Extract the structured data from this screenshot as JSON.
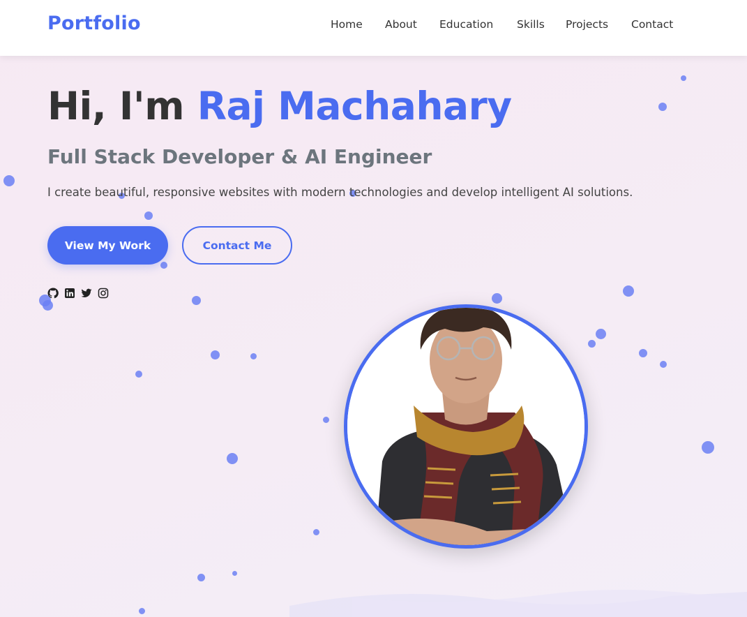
{
  "brand": {
    "logo": "Portfolio",
    "accent": "#4a6cf0"
  },
  "nav": {
    "items": [
      {
        "label": "Home"
      },
      {
        "label": "About"
      },
      {
        "label": "Education"
      },
      {
        "label": "Skills"
      },
      {
        "label": "Projects"
      },
      {
        "label": "Contact"
      }
    ]
  },
  "hero": {
    "greeting": "Hi, I'm ",
    "name": "Raj Machahary",
    "subtitle": "Full Stack Developer & AI Engineer",
    "description": "I create beautiful, responsive websites with modern technologies and develop intelligent AI solutions.",
    "primary_button": "View My Work",
    "secondary_button": "Contact Me"
  },
  "socials": [
    {
      "icon": "github-icon"
    },
    {
      "icon": "linkedin-icon"
    },
    {
      "icon": "twitter-icon"
    },
    {
      "icon": "instagram-icon"
    }
  ],
  "profile_image": {
    "icon": "profile-photo"
  },
  "colors": {
    "accent": "#4a6cf0",
    "heading": "#333333",
    "subtitle": "#6c757d",
    "background": "#f6e9f3"
  }
}
